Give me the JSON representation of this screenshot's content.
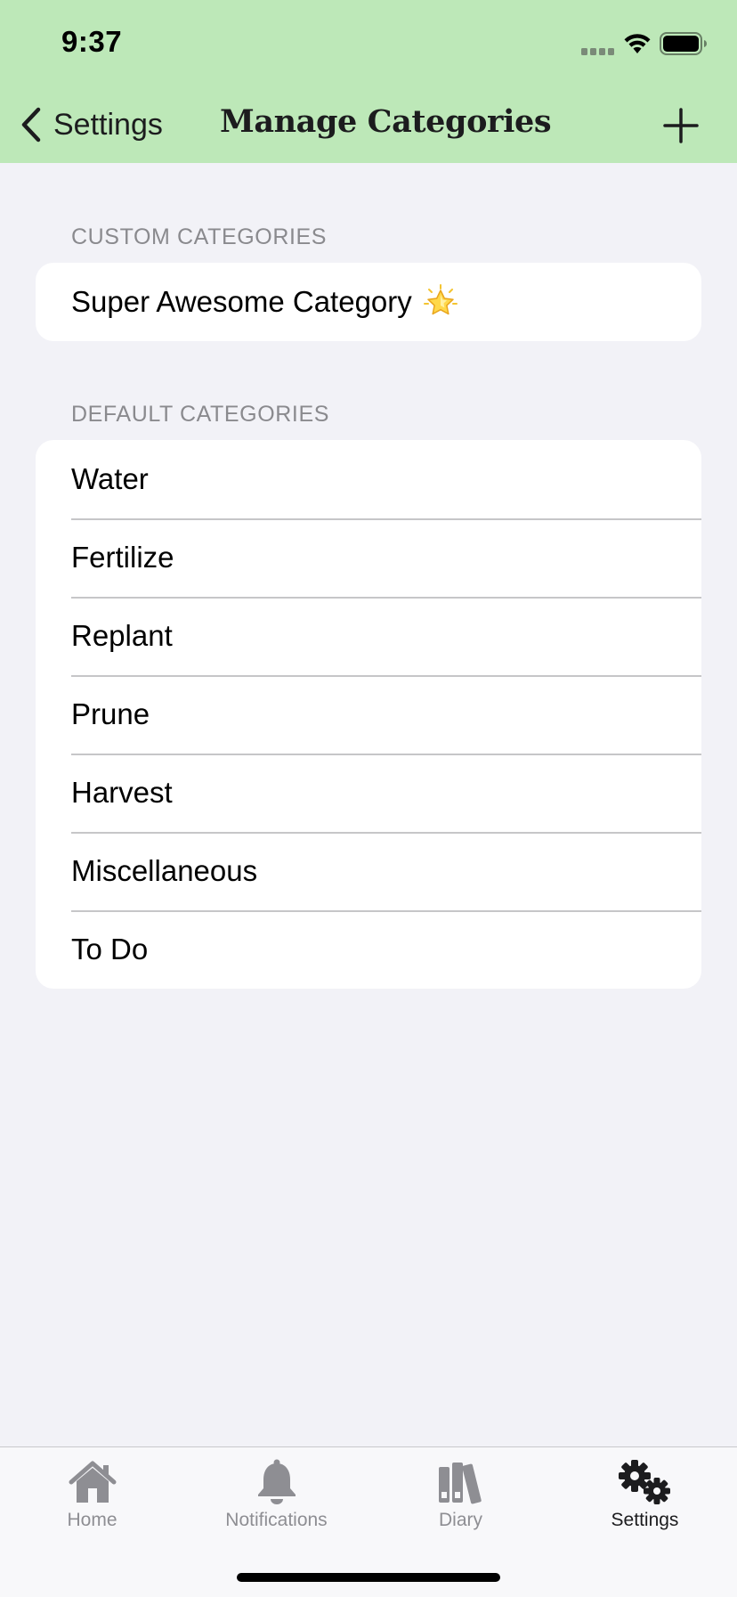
{
  "status_bar": {
    "time": "9:37"
  },
  "nav": {
    "back_label": "Settings",
    "title": "Manage Categories",
    "add_icon": "plus-icon"
  },
  "custom_section": {
    "header": "CUSTOM CATEGORIES",
    "items": [
      {
        "label": "Super Awesome Category",
        "emoji": "glowing-star-icon"
      }
    ]
  },
  "default_section": {
    "header": "DEFAULT CATEGORIES",
    "items": [
      {
        "label": "Water"
      },
      {
        "label": "Fertilize"
      },
      {
        "label": "Replant"
      },
      {
        "label": "Prune"
      },
      {
        "label": "Harvest"
      },
      {
        "label": "Miscellaneous"
      },
      {
        "label": "To Do"
      }
    ]
  },
  "tab_bar": {
    "tabs": [
      {
        "label": "Home",
        "icon": "house-icon",
        "active": false
      },
      {
        "label": "Notifications",
        "icon": "bell-icon",
        "active": false
      },
      {
        "label": "Diary",
        "icon": "books-icon",
        "active": false
      },
      {
        "label": "Settings",
        "icon": "gears-icon",
        "active": true
      }
    ]
  },
  "colors": {
    "header_background": "#bde8b8",
    "page_background": "#f2f2f7",
    "active_tab": "#1c1c1e",
    "inactive_tab": "#8e8e93"
  }
}
